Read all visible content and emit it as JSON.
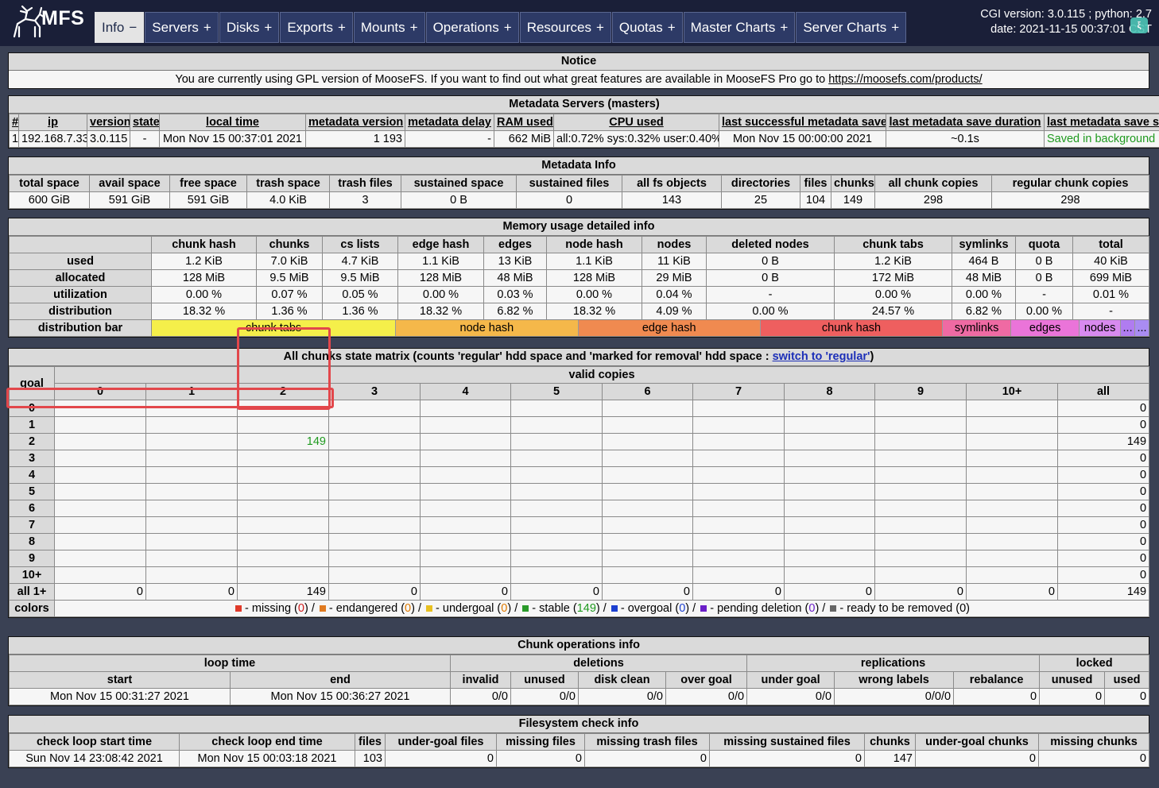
{
  "brand": {
    "logo_text": "MFS"
  },
  "nav": {
    "tabs": [
      {
        "label": "Info",
        "mark": "−",
        "active": true
      },
      {
        "label": "Servers",
        "mark": "+"
      },
      {
        "label": "Disks",
        "mark": "+"
      },
      {
        "label": "Exports",
        "mark": "+"
      },
      {
        "label": "Mounts",
        "mark": "+"
      },
      {
        "label": "Operations",
        "mark": "+"
      },
      {
        "label": "Resources",
        "mark": "+"
      },
      {
        "label": "Quotas",
        "mark": "+"
      },
      {
        "label": "Master Charts",
        "mark": "+"
      },
      {
        "label": "Server Charts",
        "mark": "+"
      }
    ]
  },
  "header": {
    "cgi_line": "CGI version: 3.0.115 ; python: 2.7",
    "date_line": "date: 2021-11-15 00:37:01 CST"
  },
  "notice": {
    "title": "Notice",
    "text": "You are currently using GPL version of MooseFS. If you want to find out what great features are available in MooseFS Pro go to",
    "link": "https://moosefs.com/products/"
  },
  "masters": {
    "title": "Metadata Servers (masters)",
    "headers": [
      "#",
      "ip",
      "version",
      "state",
      "local time",
      "metadata version",
      "metadata delay",
      "RAM used",
      "CPU used",
      "last successful metadata save",
      "last metadata save duration",
      "last metadata save status"
    ],
    "row": [
      "1",
      "192.168.7.33",
      "3.0.115",
      "-",
      "Mon Nov 15 00:37:01 2021",
      "1 193",
      "-",
      "662 MiB",
      "all:0.72% sys:0.32% user:0.40%",
      "Mon Nov 15 00:00:00 2021",
      "~0.1s",
      "Saved in background"
    ]
  },
  "metainfo": {
    "title": "Metadata Info",
    "headers": [
      "total space",
      "avail space",
      "free space",
      "trash space",
      "trash files",
      "sustained space",
      "sustained files",
      "all fs objects",
      "directories",
      "files",
      "chunks",
      "all chunk copies",
      "regular chunk copies"
    ],
    "row": [
      "600 GiB",
      "591 GiB",
      "591 GiB",
      "4.0 KiB",
      "3",
      "0 B",
      "0",
      "143",
      "25",
      "104",
      "149",
      "298",
      "298"
    ]
  },
  "memory": {
    "title": "Memory usage detailed info",
    "headers": [
      "",
      "chunk hash",
      "chunks",
      "cs lists",
      "edge hash",
      "edges",
      "node hash",
      "nodes",
      "deleted nodes",
      "chunk tabs",
      "symlinks",
      "quota",
      "total"
    ],
    "rows": [
      {
        "label": "used",
        "cells": [
          "1.2 KiB",
          "7.0 KiB",
          "4.7 KiB",
          "1.1 KiB",
          "13 KiB",
          "1.1 KiB",
          "11 KiB",
          "0 B",
          "1.2 KiB",
          "464 B",
          "0 B",
          "40 KiB"
        ]
      },
      {
        "label": "allocated",
        "cells": [
          "128 MiB",
          "9.5 MiB",
          "9.5 MiB",
          "128 MiB",
          "48 MiB",
          "128 MiB",
          "29 MiB",
          "0 B",
          "172 MiB",
          "48 MiB",
          "0 B",
          "699 MiB"
        ]
      },
      {
        "label": "utilization",
        "cells": [
          "0.00 %",
          "0.07 %",
          "0.05 %",
          "0.00 %",
          "0.03 %",
          "0.00 %",
          "0.04 %",
          "-",
          "0.00 %",
          "0.00 %",
          "-",
          "0.01 %"
        ]
      },
      {
        "label": "distribution",
        "cells": [
          "18.32 %",
          "1.36 %",
          "1.36 %",
          "18.32 %",
          "6.82 %",
          "18.32 %",
          "4.09 %",
          "0.00 %",
          "24.57 %",
          "6.82 %",
          "0.00 %",
          "-"
        ]
      }
    ],
    "bar_label": "distribution bar",
    "bar": [
      {
        "label": "chunk tabs",
        "frac": 24.57,
        "color": "#f5ef4a"
      },
      {
        "label": "node hash",
        "frac": 18.32,
        "color": "#f5b84a"
      },
      {
        "label": "edge hash",
        "frac": 18.32,
        "color": "#f08a50"
      },
      {
        "label": "chunk hash",
        "frac": 18.32,
        "color": "#ee5f5f"
      },
      {
        "label": "symlinks",
        "frac": 6.82,
        "color": "#ef6aa3"
      },
      {
        "label": "edges",
        "frac": 6.82,
        "color": "#ea74d9"
      },
      {
        "label": "nodes",
        "frac": 4.09,
        "color": "#d88aef"
      },
      {
        "label": "...",
        "frac": 1.36,
        "color": "#b07cf0"
      },
      {
        "label": "...",
        "frac": 1.36,
        "color": "#a98cf2"
      }
    ]
  },
  "matrix": {
    "title_pre": "All chunks state matrix (counts 'regular' hdd space and 'marked for removal' hdd space :",
    "switch_link": "switch to 'regular'",
    "title_post": ")",
    "goal_label": "goal",
    "valid_label": "valid copies",
    "col_headers": [
      "0",
      "1",
      "2",
      "3",
      "4",
      "5",
      "6",
      "7",
      "8",
      "9",
      "10+",
      "all"
    ],
    "rows": [
      {
        "goal": "0",
        "cells": [
          "",
          "",
          "",
          "",
          "",
          "",
          "",
          "",
          "",
          "",
          "",
          "0"
        ]
      },
      {
        "goal": "1",
        "cells": [
          "",
          "",
          "",
          "",
          "",
          "",
          "",
          "",
          "",
          "",
          "",
          "0"
        ]
      },
      {
        "goal": "2",
        "cells": [
          "",
          "",
          "149",
          "",
          "",
          "",
          "",
          "",
          "",
          "",
          "",
          "149"
        ]
      },
      {
        "goal": "3",
        "cells": [
          "",
          "",
          "",
          "",
          "",
          "",
          "",
          "",
          "",
          "",
          "",
          "0"
        ]
      },
      {
        "goal": "4",
        "cells": [
          "",
          "",
          "",
          "",
          "",
          "",
          "",
          "",
          "",
          "",
          "",
          "0"
        ]
      },
      {
        "goal": "5",
        "cells": [
          "",
          "",
          "",
          "",
          "",
          "",
          "",
          "",
          "",
          "",
          "",
          "0"
        ]
      },
      {
        "goal": "6",
        "cells": [
          "",
          "",
          "",
          "",
          "",
          "",
          "",
          "",
          "",
          "",
          "",
          "0"
        ]
      },
      {
        "goal": "7",
        "cells": [
          "",
          "",
          "",
          "",
          "",
          "",
          "",
          "",
          "",
          "",
          "",
          "0"
        ]
      },
      {
        "goal": "8",
        "cells": [
          "",
          "",
          "",
          "",
          "",
          "",
          "",
          "",
          "",
          "",
          "",
          "0"
        ]
      },
      {
        "goal": "9",
        "cells": [
          "",
          "",
          "",
          "",
          "",
          "",
          "",
          "",
          "",
          "",
          "",
          "0"
        ]
      },
      {
        "goal": "10+",
        "cells": [
          "",
          "",
          "",
          "",
          "",
          "",
          "",
          "",
          "",
          "",
          "",
          "0"
        ]
      }
    ],
    "total_row": {
      "goal": "all 1+",
      "cells": [
        "0",
        "0",
        "149",
        "0",
        "0",
        "0",
        "0",
        "0",
        "0",
        "0",
        "0",
        "149"
      ]
    },
    "colors_label": "colors",
    "legend": [
      {
        "color": "#e03a2a",
        "label": "missing",
        "count": "0",
        "cls": "red"
      },
      {
        "color": "#e07a20",
        "label": "endangered",
        "count": "0",
        "cls": "orange"
      },
      {
        "color": "#e8c020",
        "label": "undergoal",
        "count": "0",
        "cls": "orange"
      },
      {
        "color": "#2a9a2a",
        "label": "stable",
        "count": "149",
        "cls": "green"
      },
      {
        "color": "#1c3fd0",
        "label": "overgoal",
        "count": "0",
        "cls": "blue"
      },
      {
        "color": "#6a1ec8",
        "label": "pending deletion",
        "count": "0",
        "cls": "purple"
      },
      {
        "color": "#666666",
        "label": "ready to be removed",
        "count": "0",
        "cls": ""
      }
    ]
  },
  "chunkops": {
    "title": "Chunk operations info",
    "groups": [
      "loop time",
      "deletions",
      "replications",
      "locked"
    ],
    "headers": [
      "start",
      "end",
      "invalid",
      "unused",
      "disk clean",
      "over goal",
      "under goal",
      "wrong labels",
      "rebalance",
      "unused",
      "used"
    ],
    "row": [
      "Mon Nov 15 00:31:27 2021",
      "Mon Nov 15 00:36:27 2021",
      "0/0",
      "0/0",
      "0/0",
      "0/0",
      "0/0",
      "0/0/0",
      "0",
      "0",
      "0"
    ]
  },
  "fscheck": {
    "title": "Filesystem check info",
    "headers": [
      "check loop start time",
      "check loop end time",
      "files",
      "under-goal files",
      "missing files",
      "missing trash files",
      "missing sustained files",
      "chunks",
      "under-goal chunks",
      "missing chunks"
    ],
    "row": [
      "Sun Nov 14 23:08:42 2021",
      "Mon Nov 15 00:03:18 2021",
      "103",
      "0",
      "0",
      "0",
      "0",
      "147",
      "0",
      "0"
    ]
  }
}
